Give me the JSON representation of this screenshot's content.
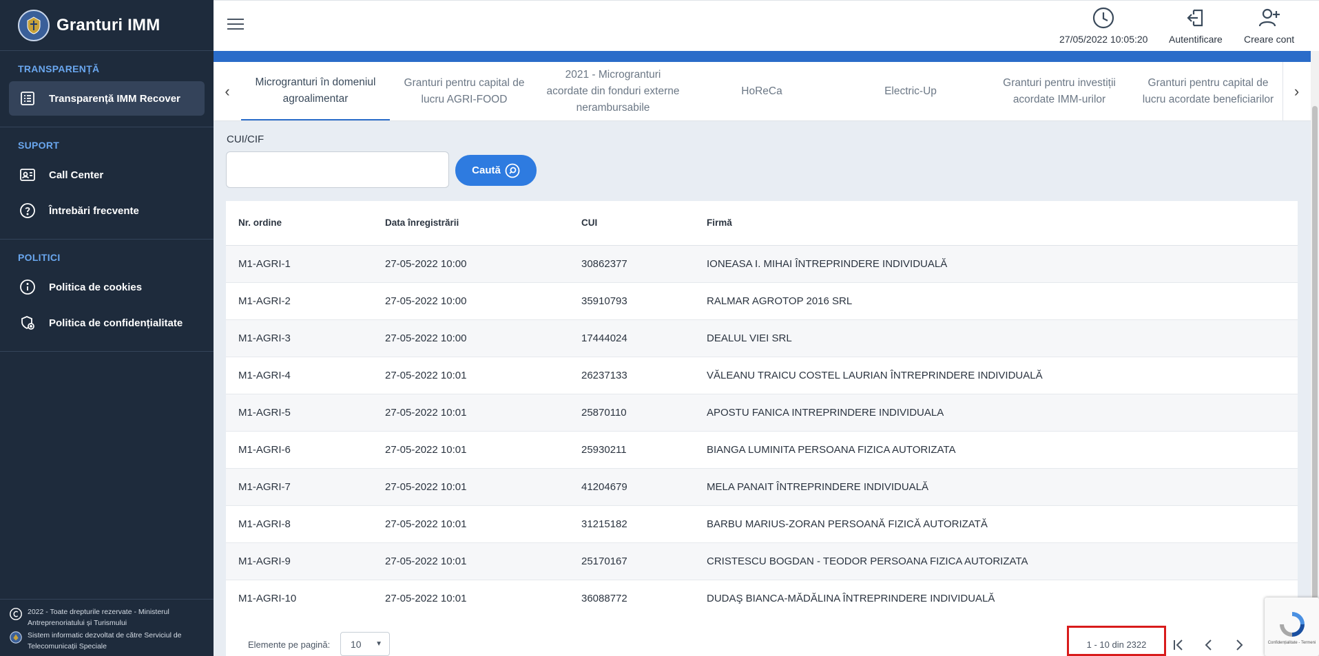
{
  "brand": {
    "title": "Granturi IMM"
  },
  "sidebar": {
    "sections": [
      {
        "title": "TRANSPARENȚĂ",
        "items": [
          {
            "label": "Transparență IMM Recover",
            "icon": "list-icon"
          }
        ]
      },
      {
        "title": "SUPORT",
        "items": [
          {
            "label": "Call Center",
            "icon": "contact-card-icon"
          },
          {
            "label": "Întrebări frecvente",
            "icon": "question-icon"
          }
        ]
      },
      {
        "title": "POLITICI",
        "items": [
          {
            "label": "Politica de cookies",
            "icon": "info-icon"
          },
          {
            "label": "Politica de confidențialitate",
            "icon": "shield-icon"
          }
        ]
      }
    ],
    "footer": {
      "copyright": "2022 - Toate drepturile rezervate - Ministerul Antreprenoriatului și Turismului",
      "system": "Sistem informatic dezvoltat de către Serviciul de Telecomunicații Speciale"
    }
  },
  "header": {
    "datetime": "27/05/2022 10:05:20",
    "login": "Autentificare",
    "register": "Creare cont"
  },
  "tabs": [
    "Microgranturi în domeniul agroalimentar",
    "Granturi pentru capital de lucru AGRI-FOOD",
    "2021 - Microgranturi acordate din fonduri externe nerambursabile",
    "HoReCa",
    "Electric-Up",
    "Granturi pentru investiții acordate IMM-urilor",
    "Granturi pentru capital de lucru acordate beneficiarilor"
  ],
  "search": {
    "label": "CUI/CIF",
    "value": "",
    "button": "Caută"
  },
  "table": {
    "headers": [
      "Nr. ordine",
      "Data înregistrării",
      "CUI",
      "Firmă"
    ],
    "rows": [
      [
        "M1-AGRI-1",
        "27-05-2022 10:00",
        "30862377",
        "IONEASA I. MIHAI ÎNTREPRINDERE INDIVIDUALĂ"
      ],
      [
        "M1-AGRI-2",
        "27-05-2022 10:00",
        "35910793",
        "RALMAR AGROTOP 2016 SRL"
      ],
      [
        "M1-AGRI-3",
        "27-05-2022 10:00",
        "17444024",
        "DEALUL VIEI SRL"
      ],
      [
        "M1-AGRI-4",
        "27-05-2022 10:01",
        "26237133",
        "VĂLEANU TRAICU COSTEL LAURIAN ÎNTREPRINDERE INDIVIDUALĂ"
      ],
      [
        "M1-AGRI-5",
        "27-05-2022 10:01",
        "25870110",
        "APOSTU FANICA INTREPRINDERE INDIVIDUALA"
      ],
      [
        "M1-AGRI-6",
        "27-05-2022 10:01",
        "25930211",
        "BIANGA LUMINITA PERSOANA FIZICA AUTORIZATA"
      ],
      [
        "M1-AGRI-7",
        "27-05-2022 10:01",
        "41204679",
        "MELA PANAIT ÎNTREPRINDERE INDIVIDUALĂ"
      ],
      [
        "M1-AGRI-8",
        "27-05-2022 10:01",
        "31215182",
        "BARBU MARIUS-ZORAN PERSOANĂ FIZICĂ AUTORIZATĂ"
      ],
      [
        "M1-AGRI-9",
        "27-05-2022 10:01",
        "25170167",
        "CRISTESCU BOGDAN - TEODOR PERSOANA FIZICA AUTORIZATA"
      ],
      [
        "M1-AGRI-10",
        "27-05-2022 10:01",
        "36088772",
        "DUDAŞ BIANCA-MĂDĂLINA ÎNTREPRINDERE INDIVIDUALĂ"
      ]
    ]
  },
  "pagination": {
    "per_page_label": "Elemente pe pagină:",
    "per_page": "10",
    "range": "1 - 10 din 2322"
  },
  "recaptcha": {
    "text": "Confidențialitate - Termeni"
  }
}
